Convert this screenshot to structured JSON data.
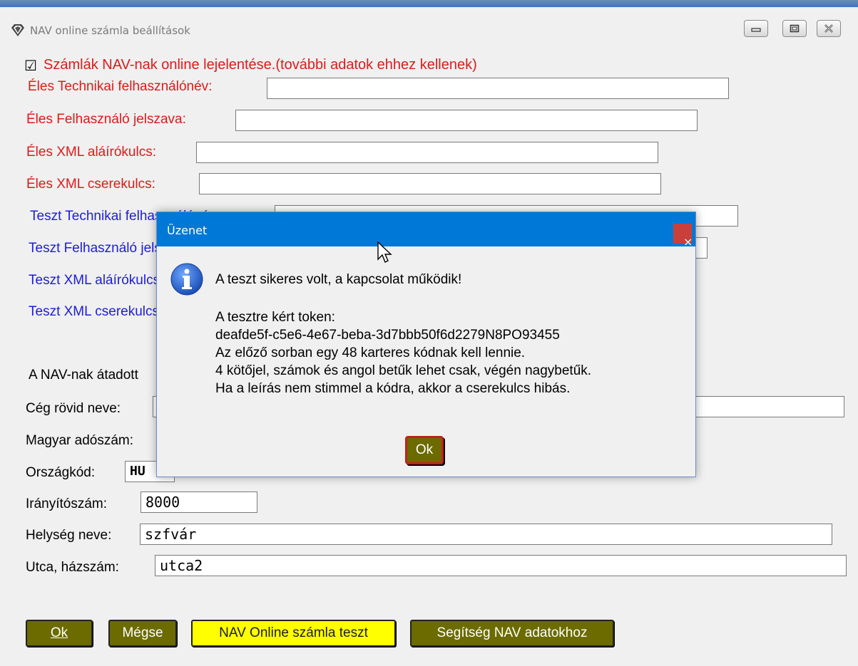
{
  "window": {
    "title": "NAV online számla beállítások"
  },
  "form": {
    "checkbox_mark": "☑",
    "checkbox_label": "Számlák NAV-nak online lejelentése.(további adatok ehhez kellenek)",
    "live_user_label": "Éles Technikai felhasználónév:",
    "live_password_label": "Éles Felhasználó jelszava:",
    "live_signkey_label": "Éles XML aláírókulcs:",
    "live_exchkey_label": "Éles XML cserekulcs:",
    "test_user_label": "Teszt Technikai felhasználónév:",
    "test_password_label": "Teszt Felhasználó jelszava:",
    "test_signkey_label": "Teszt XML aláírókulcs:",
    "test_exchkey_label": "Teszt XML cserekulcs:",
    "nav_data_label": "A NAV-nak átadott",
    "company_short_label": "Cég rövid neve:",
    "tax_number_label": "Magyar adószám:",
    "country_code_label": "Országkód:",
    "country_code_value": "HU",
    "zip_label": "Irányítószám:",
    "zip_value": "8000",
    "city_label": "Helység neve:",
    "city_value": "szfvár",
    "street_label": "Utca, házszám:",
    "street_value": "utca2"
  },
  "buttons": {
    "ok_label": "Ok",
    "cancel_label": "Mégse",
    "nav_test_label": "NAV Online számla teszt",
    "help_label": "Segítség NAV adatokhoz"
  },
  "dialog": {
    "title": "Üzenet",
    "close_glyph": "×",
    "line1": "A teszt sikeres volt, a kapcsolat működik!",
    "line2": "A tesztre kért token:",
    "line3": "deafde5f-c5e6-4e67-beba-3d7bbb50f6d2279N8PO93455",
    "line4": "Az előző sorban egy 48 karteres kódnak kell lennie.",
    "line5": "4 kötőjel, számok és angol betűk lehet csak, végén nagybetűk.",
    "line6": "Ha a leírás nem stimmel a kódra, akkor a cserekulcs hibás.",
    "ok_label": "Ok"
  },
  "colors": {
    "live_label": "#e01a1a",
    "test_label": "#1c1ce0",
    "button_olive": "#6b6b00",
    "button_yellow": "#ffff00",
    "dialog_titlebar": "#0078d7"
  },
  "icons": {
    "app": "app-logo-icon",
    "minimize": "minimize-icon",
    "maximize": "maximize-icon",
    "close": "close-icon",
    "info": "info-icon",
    "cursor": "mouse-cursor-icon"
  }
}
